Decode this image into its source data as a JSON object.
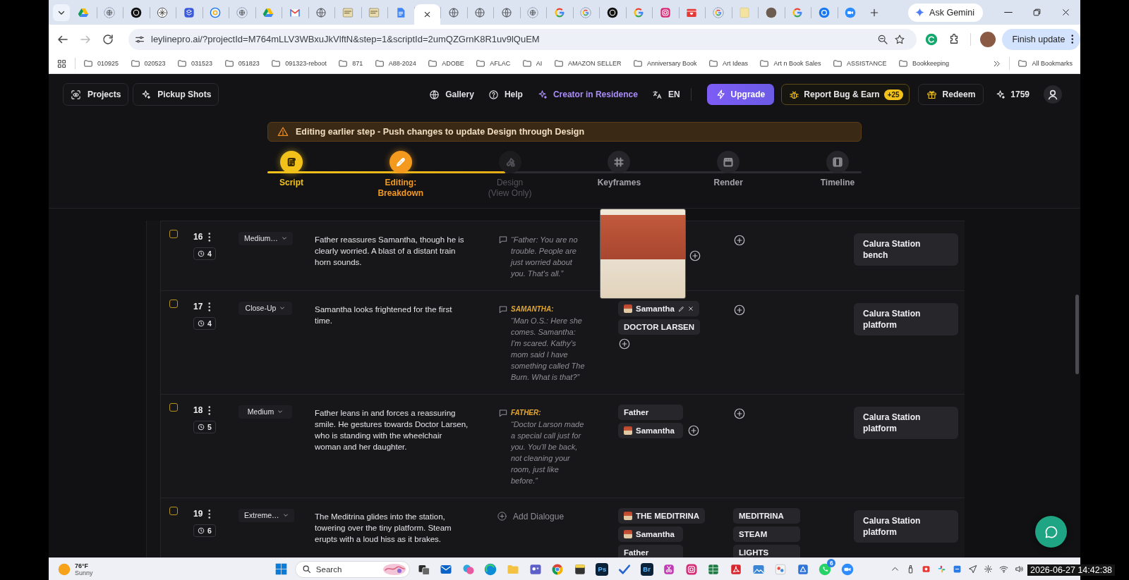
{
  "browser": {
    "tabs": [
      {
        "kind": "drive",
        "selected": false
      },
      {
        "kind": "globe-dashed",
        "selected": false
      },
      {
        "kind": "dark-circle",
        "selected": false
      },
      {
        "kind": "knot",
        "selected": false
      },
      {
        "kind": "shield",
        "selected": false
      },
      {
        "kind": "loop",
        "selected": false
      },
      {
        "kind": "globe-dashed",
        "selected": false
      },
      {
        "kind": "drive",
        "selected": false
      },
      {
        "kind": "gmail",
        "selected": false
      },
      {
        "kind": "globe",
        "selected": false
      },
      {
        "kind": "thumbnail",
        "selected": false
      },
      {
        "kind": "thumbnail",
        "selected": false
      },
      {
        "kind": "docs",
        "selected": false
      },
      {
        "selected": true
      },
      {
        "kind": "globe",
        "selected": false
      },
      {
        "kind": "globe",
        "selected": false
      },
      {
        "kind": "globe",
        "selected": false
      },
      {
        "kind": "globe-dashed",
        "selected": false
      },
      {
        "kind": "google",
        "selected": false
      },
      {
        "kind": "google-dashed",
        "selected": false
      },
      {
        "kind": "dark-circle",
        "selected": false
      },
      {
        "kind": "google",
        "selected": false
      },
      {
        "kind": "instagram",
        "selected": false
      },
      {
        "kind": "red-box",
        "selected": false
      },
      {
        "kind": "google-dashed",
        "selected": false
      },
      {
        "kind": "note",
        "selected": false
      },
      {
        "kind": "avatar",
        "selected": false
      },
      {
        "kind": "google",
        "selected": false
      },
      {
        "kind": "facebook",
        "selected": false
      },
      {
        "kind": "zoom",
        "selected": false
      }
    ],
    "gemini_button": "Ask Gemini",
    "url": "leylinepro.ai/?projectId=M764mLLV3WBxuJkVlftN&step=1&scriptId=2umQZGrnK8R1uv9lQuEM",
    "update_button": "Finish update",
    "bookmarks": [
      "010925",
      "020523",
      "031523",
      "051823",
      "091323-reboot",
      "871",
      "A88-2024",
      "ADOBE",
      "AFLAC",
      "AI",
      "AMAZON SELLER",
      "Anniversary Book",
      "Art Ideas",
      "Art n Book Sales",
      "ASSISTANCE",
      "Bookkeeping"
    ],
    "all_bookmarks": "All Bookmarks"
  },
  "header": {
    "nav": [
      {
        "kind": "projects",
        "label": "Projects"
      },
      {
        "kind": "pickup",
        "label": "Pickup Shots"
      }
    ],
    "links": [
      {
        "kind": "gallery",
        "label": "Gallery"
      },
      {
        "kind": "help",
        "label": "Help"
      },
      {
        "kind": "creator",
        "label": "Creator in Residence"
      },
      {
        "kind": "language",
        "label": "EN"
      }
    ],
    "upgrade": "Upgrade",
    "report": {
      "label": "Report Bug & Earn",
      "badge": "+25"
    },
    "redeem": "Redeem",
    "credits": "1759"
  },
  "banner": {
    "text": "Editing earlier step - Push changes to update Design through Design"
  },
  "stepper": {
    "level": 0.4,
    "steps": [
      {
        "label": "Script",
        "completed": true,
        "selected": false,
        "disabled": false
      },
      {
        "label": "Editing: Breakdown",
        "completed": false,
        "selected": true,
        "disabled": false
      },
      {
        "label": "Design (View Only)",
        "completed": false,
        "selected": false,
        "disabled": true
      },
      {
        "label": "Keyframes",
        "completed": false,
        "selected": false,
        "disabled": false
      },
      {
        "label": "Render",
        "completed": false,
        "selected": false,
        "disabled": false
      },
      {
        "label": "Timeline",
        "completed": false,
        "selected": false,
        "disabled": false
      }
    ]
  },
  "shots": [
    {
      "checked": false,
      "number": "16",
      "duration": "4",
      "shot_type": "Medium…",
      "description": "Father reassures Samantha, though he is clearly worried. A blast of a distant train horn sounds.",
      "dialogue": {
        "kind": "line",
        "text": "“Father: You are no trouble. People are just worried about you. That's all.”"
      },
      "add_character": true,
      "add_prop": true,
      "location": "Calura Station bench"
    },
    {
      "checked": false,
      "number": "17",
      "duration": "4",
      "shot_type": "Close-Up",
      "description": "Samantha looks frightened for the first time.",
      "dialogue": {
        "kind": "line",
        "speaker": "SAMANTHA:",
        "text": "“Man O.S.: Here she comes. Samantha: I'm scared. Kathy's mom said I have something called The Burn. What is that?”"
      },
      "characters": [
        {
          "name": "Samantha",
          "avatar": true,
          "hovered": true
        },
        {
          "name": "DOCTOR LARSEN",
          "avatar": false,
          "hovered": false
        }
      ],
      "add_character": true,
      "add_prop": true,
      "location": "Calura Station platform"
    },
    {
      "checked": false,
      "number": "18",
      "duration": "5",
      "shot_type": "Medium",
      "description": "Father leans in and forces a reassuring smile. He gestures towards Doctor Larsen, who is standing with the wheelchair woman and her daughter.",
      "dialogue": {
        "kind": "line",
        "speaker": "FATHER:",
        "text": "“Doctor Larson made a special call just for you. You'll be back, not cleaning your room, just like before.”"
      },
      "characters": [
        {
          "name": "Father",
          "avatar": false,
          "hovered": false
        },
        {
          "name": "Samantha",
          "avatar": true,
          "hovered": false
        }
      ],
      "add_character": true,
      "add_prop": true,
      "location": "Calura Station platform"
    },
    {
      "checked": false,
      "number": "19",
      "duration": "6",
      "shot_type": "Extreme…",
      "description": "The Meditrina glides into the station, towering over the tiny platform. Steam erupts with a loud hiss as it brakes.",
      "dialogue": {
        "kind": "add",
        "text": "Add Dialogue"
      },
      "characters": [
        {
          "name": "THE MEDITRINA",
          "avatar": true,
          "hovered": false
        },
        {
          "name": "Samantha",
          "avatar": true,
          "hovered": false
        },
        {
          "name": "Father",
          "avatar": false,
          "hovered": false
        }
      ],
      "add_character": false,
      "props": [
        "MEDITRINA",
        "STEAM",
        "LIGHTS"
      ],
      "add_prop": false,
      "location": "Calura Station platform"
    }
  ],
  "taskbar": {
    "weather": {
      "temperature": "76°F",
      "condition": "Sunny"
    },
    "search": {
      "placeholder": "Search"
    },
    "apps": [
      {
        "kind": "task-view"
      },
      {
        "kind": "mail"
      },
      {
        "kind": "copilot"
      },
      {
        "kind": "edge"
      },
      {
        "kind": "folder"
      },
      {
        "kind": "teams"
      },
      {
        "kind": "chrome"
      },
      {
        "kind": "sticky"
      },
      {
        "kind": "tile",
        "label": "Ps"
      },
      {
        "kind": "todo"
      },
      {
        "kind": "tile",
        "label": "Br"
      },
      {
        "kind": "snip"
      },
      {
        "kind": "instagram"
      },
      {
        "kind": "excel"
      },
      {
        "kind": "acrobat"
      },
      {
        "kind": "photos"
      },
      {
        "kind": "paint"
      },
      {
        "kind": "app"
      },
      {
        "kind": "whatsapp",
        "badge": "6"
      },
      {
        "kind": "zoom"
      }
    ]
  },
  "recording_timestamp": "2026-06-27 14:42:38"
}
